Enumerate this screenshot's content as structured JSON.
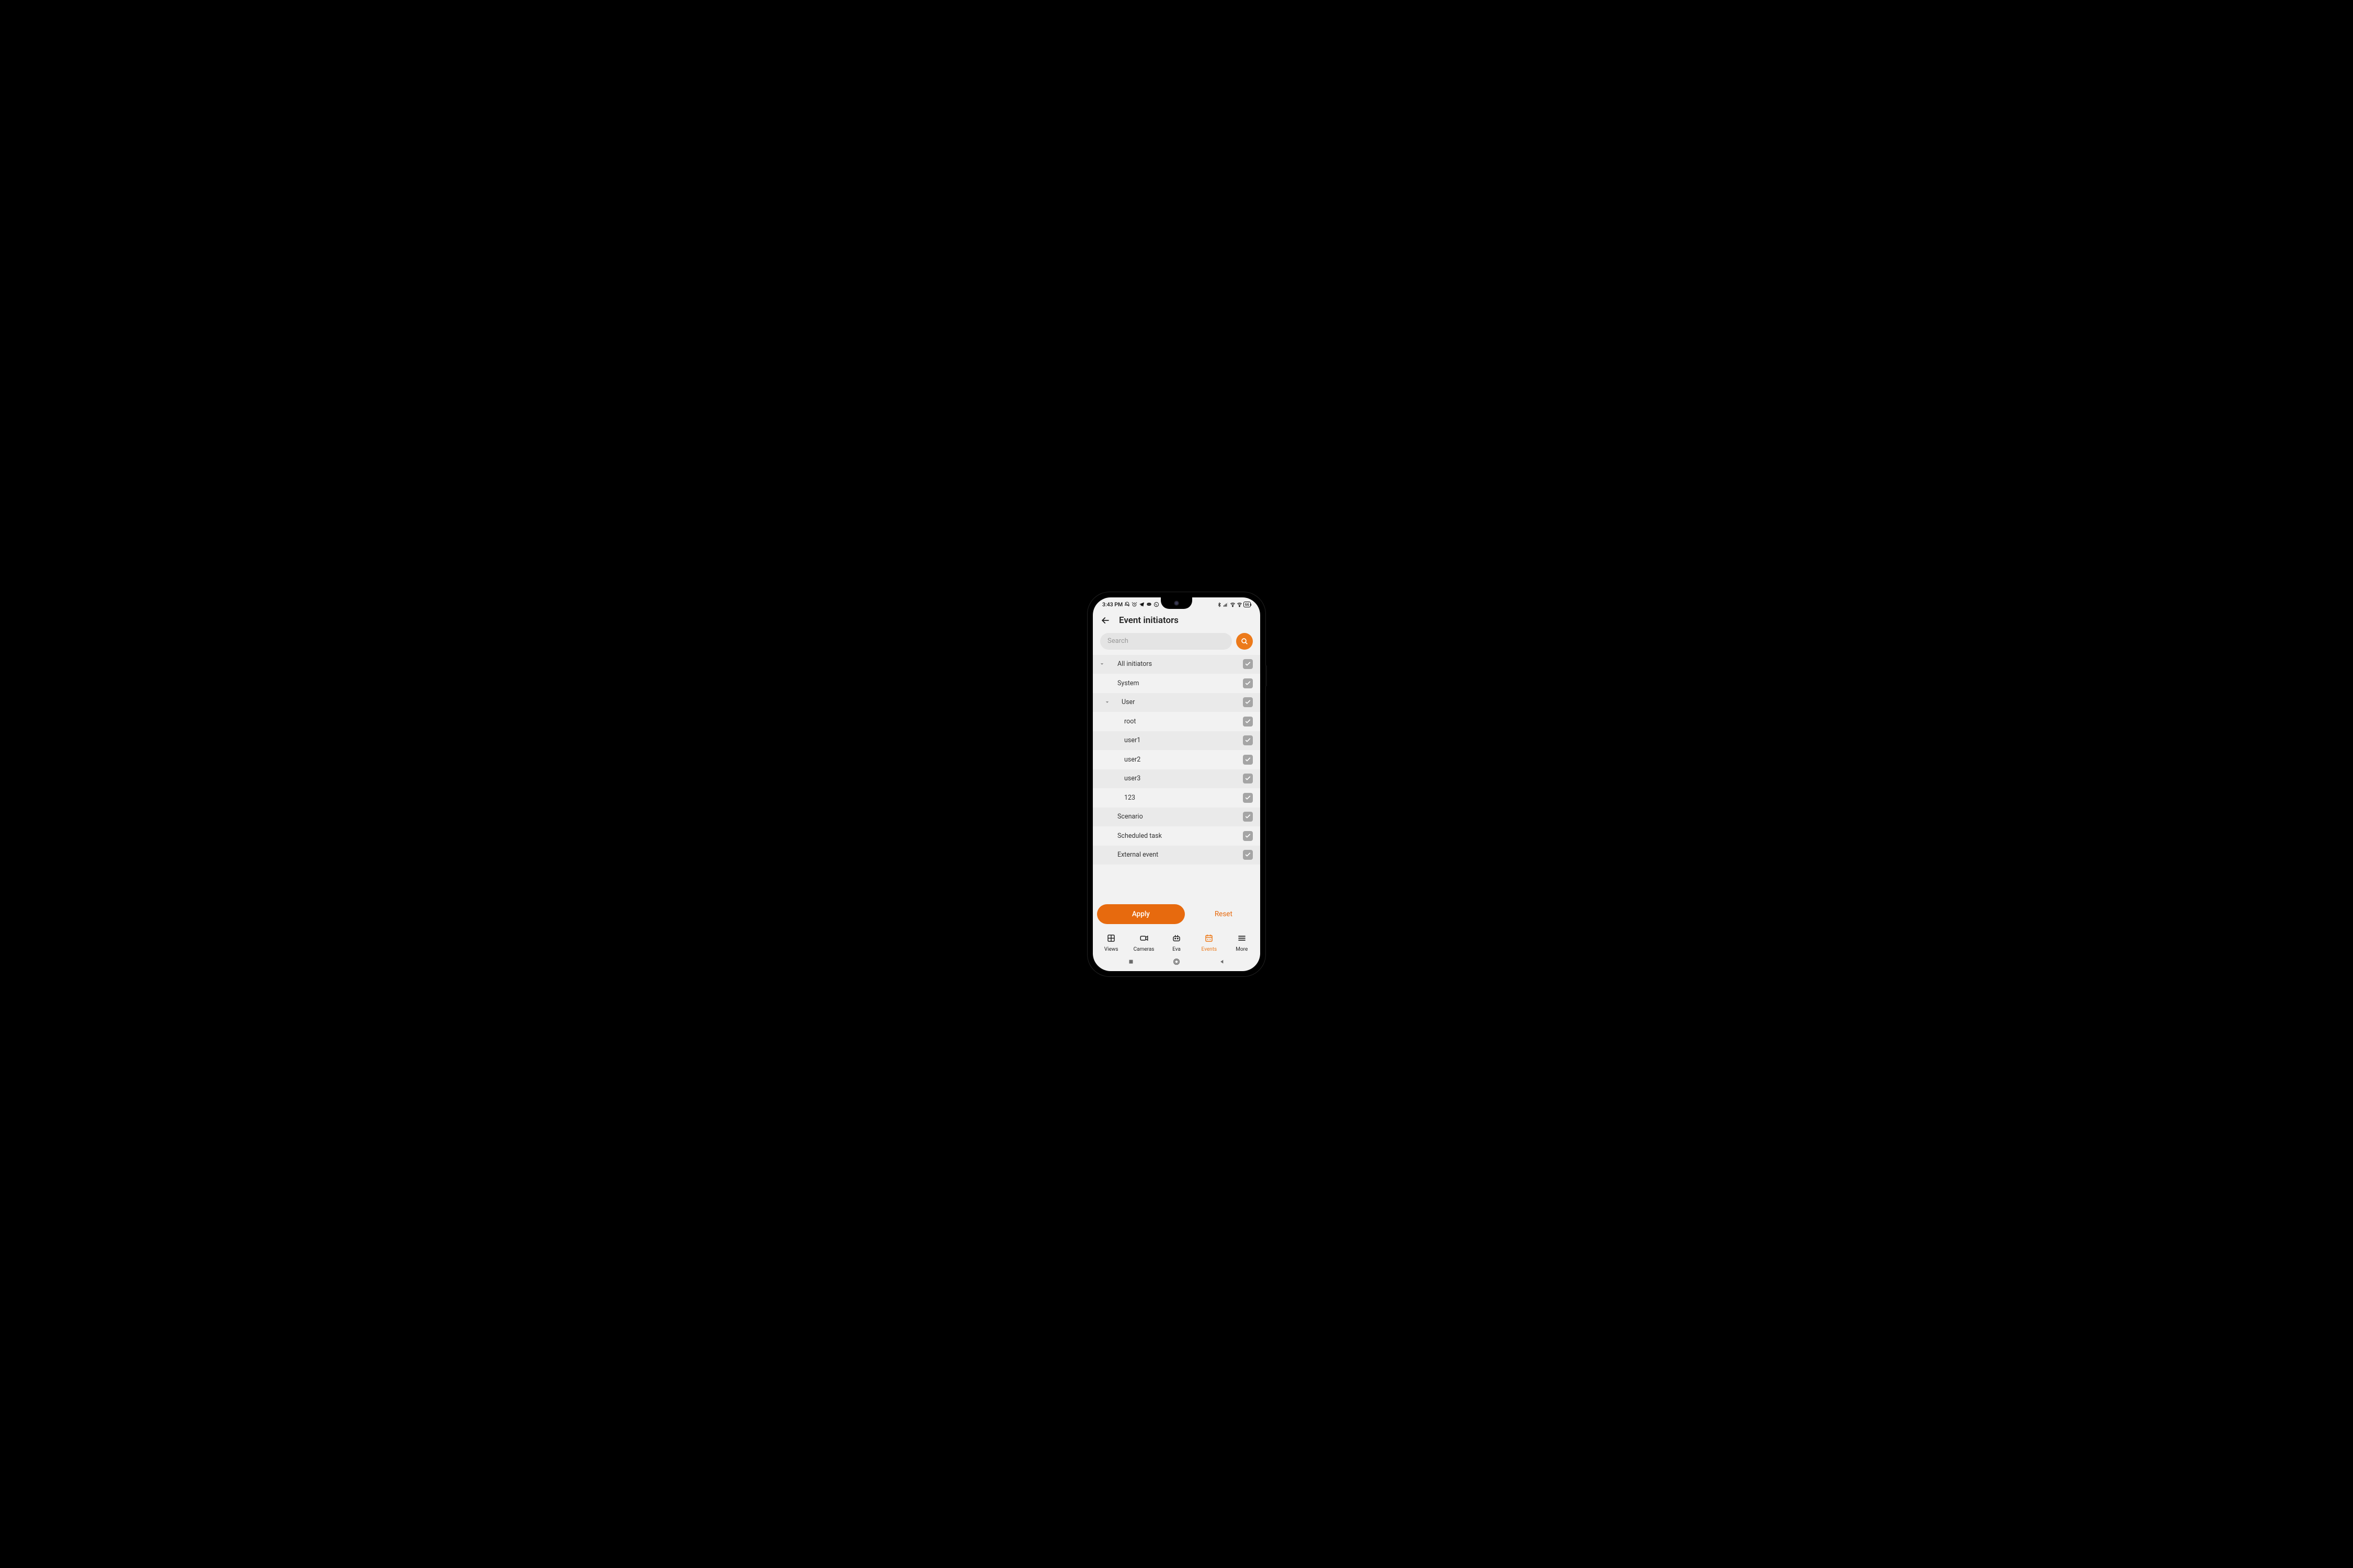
{
  "status": {
    "time": "3:43 PM",
    "battery": "66"
  },
  "header": {
    "title": "Event initiators"
  },
  "search": {
    "placeholder": "Search"
  },
  "list": [
    {
      "label": "All initiators",
      "indent": 0,
      "arrow": true,
      "checked": true,
      "shade": true
    },
    {
      "label": "System",
      "indent": 1,
      "arrow": false,
      "checked": true,
      "shade": false
    },
    {
      "label": "User",
      "indent": 1,
      "arrow": true,
      "checked": true,
      "shade": true,
      "arrowIndent": true
    },
    {
      "label": "root",
      "indent": 2,
      "arrow": false,
      "checked": true,
      "shade": false
    },
    {
      "label": "user1",
      "indent": 2,
      "arrow": false,
      "checked": true,
      "shade": true
    },
    {
      "label": "user2",
      "indent": 2,
      "arrow": false,
      "checked": true,
      "shade": false
    },
    {
      "label": "user3",
      "indent": 2,
      "arrow": false,
      "checked": true,
      "shade": true
    },
    {
      "label": "123",
      "indent": 2,
      "arrow": false,
      "checked": true,
      "shade": false
    },
    {
      "label": "Scenario",
      "indent": 1,
      "arrow": false,
      "checked": true,
      "shade": true
    },
    {
      "label": "Scheduled task",
      "indent": 1,
      "arrow": false,
      "checked": true,
      "shade": false
    },
    {
      "label": "External event",
      "indent": 1,
      "arrow": false,
      "checked": true,
      "shade": true
    }
  ],
  "buttons": {
    "apply": "Apply",
    "reset": "Reset"
  },
  "tabs": [
    {
      "label": "Views",
      "active": false
    },
    {
      "label": "Cameras",
      "active": false
    },
    {
      "label": "Eva",
      "active": false
    },
    {
      "label": "Events",
      "active": true
    },
    {
      "label": "More",
      "active": false
    }
  ]
}
